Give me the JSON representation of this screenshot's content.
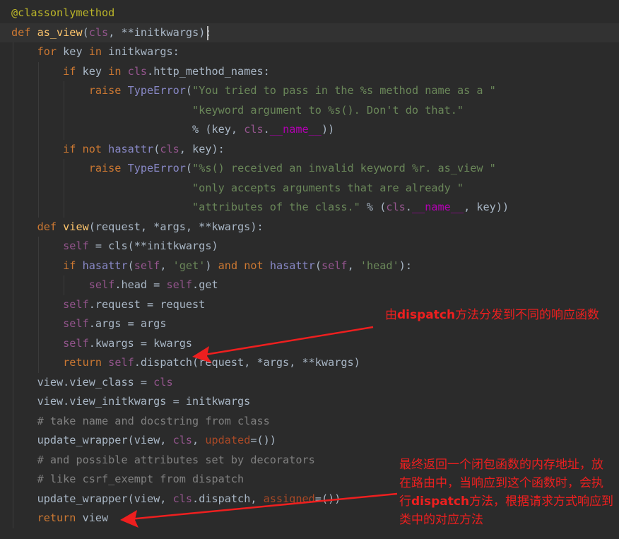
{
  "code_lines": [
    [
      {
        "t": "@classonlymethod",
        "c": "deco"
      }
    ],
    [
      {
        "t": "def ",
        "c": "kw"
      },
      {
        "t": "as_view",
        "c": "fn"
      },
      {
        "t": "("
      },
      {
        "t": "cls",
        "c": "self"
      },
      {
        "t": ", "
      },
      {
        "t": "**",
        "c": ""
      },
      {
        "t": "initkwargs):"
      }
    ],
    [
      {
        "t": "    "
      },
      {
        "t": "for ",
        "c": "kw"
      },
      {
        "t": "key "
      },
      {
        "t": "in ",
        "c": "kw"
      },
      {
        "t": "initkwargs:"
      }
    ],
    [
      {
        "t": "        "
      },
      {
        "t": "if ",
        "c": "kw"
      },
      {
        "t": "key "
      },
      {
        "t": "in ",
        "c": "kw"
      },
      {
        "t": "cls",
        "c": "self"
      },
      {
        "t": ".http_method_names:"
      }
    ],
    [
      {
        "t": "            "
      },
      {
        "t": "raise ",
        "c": "kw"
      },
      {
        "t": "TypeError",
        "c": "bi"
      },
      {
        "t": "("
      },
      {
        "t": "\"You tried to pass in the %s method name as a \"",
        "c": "str"
      }
    ],
    [
      {
        "t": "                            "
      },
      {
        "t": "\"keyword argument to %s(). Don't do that.\"",
        "c": "str"
      }
    ],
    [
      {
        "t": "                            "
      },
      {
        "t": "% (key, "
      },
      {
        "t": "cls",
        "c": "self"
      },
      {
        "t": "."
      },
      {
        "t": "__name__",
        "c": "dun"
      },
      {
        "t": "))"
      }
    ],
    [
      {
        "t": "        "
      },
      {
        "t": "if not ",
        "c": "kw"
      },
      {
        "t": "hasattr",
        "c": "bi"
      },
      {
        "t": "("
      },
      {
        "t": "cls",
        "c": "self"
      },
      {
        "t": ", key):"
      }
    ],
    [
      {
        "t": "            "
      },
      {
        "t": "raise ",
        "c": "kw"
      },
      {
        "t": "TypeError",
        "c": "bi"
      },
      {
        "t": "("
      },
      {
        "t": "\"%s() received an invalid keyword %r. as_view \"",
        "c": "str"
      }
    ],
    [
      {
        "t": "                            "
      },
      {
        "t": "\"only accepts arguments that are already \"",
        "c": "str"
      }
    ],
    [
      {
        "t": "                            "
      },
      {
        "t": "\"attributes of the class.\"",
        "c": "str"
      },
      {
        "t": " % ("
      },
      {
        "t": "cls",
        "c": "self"
      },
      {
        "t": "."
      },
      {
        "t": "__name__",
        "c": "dun"
      },
      {
        "t": ", key))"
      }
    ],
    [
      {
        "t": "    "
      },
      {
        "t": "def ",
        "c": "kw"
      },
      {
        "t": "view",
        "c": "fn"
      },
      {
        "t": "(request, *args, **kwargs):"
      }
    ],
    [
      {
        "t": "        "
      },
      {
        "t": "self",
        "c": "self"
      },
      {
        "t": " = cls(**initkwargs)"
      }
    ],
    [
      {
        "t": "        "
      },
      {
        "t": "if ",
        "c": "kw"
      },
      {
        "t": "hasattr",
        "c": "bi"
      },
      {
        "t": "("
      },
      {
        "t": "self",
        "c": "self"
      },
      {
        "t": ", "
      },
      {
        "t": "'get'",
        "c": "str"
      },
      {
        "t": ") "
      },
      {
        "t": "and not ",
        "c": "kw"
      },
      {
        "t": "hasattr",
        "c": "bi"
      },
      {
        "t": "("
      },
      {
        "t": "self",
        "c": "self"
      },
      {
        "t": ", "
      },
      {
        "t": "'head'",
        "c": "str"
      },
      {
        "t": "):"
      }
    ],
    [
      {
        "t": "            "
      },
      {
        "t": "self",
        "c": "self"
      },
      {
        "t": ".head = "
      },
      {
        "t": "self",
        "c": "self"
      },
      {
        "t": ".get"
      }
    ],
    [
      {
        "t": "        "
      },
      {
        "t": "self",
        "c": "self"
      },
      {
        "t": ".request = request"
      }
    ],
    [
      {
        "t": "        "
      },
      {
        "t": "self",
        "c": "self"
      },
      {
        "t": ".args = args"
      }
    ],
    [
      {
        "t": "        "
      },
      {
        "t": "self",
        "c": "self"
      },
      {
        "t": ".kwargs = kwargs"
      }
    ],
    [
      {
        "t": "        "
      },
      {
        "t": "return ",
        "c": "kw"
      },
      {
        "t": "self",
        "c": "self"
      },
      {
        "t": ".dispatch(request, *args, **kwargs)"
      }
    ],
    [
      {
        "t": "    "
      },
      {
        "t": "view.view_class = "
      },
      {
        "t": "cls",
        "c": "self"
      }
    ],
    [
      {
        "t": "    "
      },
      {
        "t": "view.view_initkwargs = initkwargs"
      }
    ],
    [
      {
        "t": "    "
      },
      {
        "t": "# take name and docstring from class",
        "c": "cmt"
      }
    ],
    [
      {
        "t": "    "
      },
      {
        "t": "update_wrapper(view, "
      },
      {
        "t": "cls",
        "c": "self"
      },
      {
        "t": ", "
      },
      {
        "t": "updated",
        "c": "par"
      },
      {
        "t": "=())"
      }
    ],
    [
      {
        "t": "    "
      },
      {
        "t": "# and possible attributes set by decorators",
        "c": "cmt"
      }
    ],
    [
      {
        "t": "    "
      },
      {
        "t": "# like csrf_exempt from dispatch",
        "c": "cmt"
      }
    ],
    [
      {
        "t": "    "
      },
      {
        "t": "update_wrapper(view, "
      },
      {
        "t": "cls",
        "c": "self"
      },
      {
        "t": ".dispatch, "
      },
      {
        "t": "assigned",
        "c": "par"
      },
      {
        "t": "=())"
      }
    ],
    [
      {
        "t": "    "
      },
      {
        "t": "return ",
        "c": "kw"
      },
      {
        "t": "view"
      }
    ]
  ],
  "annotations": {
    "dispatch_note": {
      "pre": "由",
      "hl": "dispatch",
      "post": "方法分发到不同的响应函数"
    },
    "return_note": {
      "pre": "最终返回一个闭包函数的内存地址，放在路由中，当响应到这个函数时，会执行",
      "hl": "dispatch",
      "post": "方法，根据请求方式响应到类中的对应方法"
    }
  },
  "colors": {
    "background": "#2b2b2b",
    "keyword": "#cc7832",
    "string": "#6a8759",
    "comment": "#808080",
    "annotation_red": "#ee1f1f"
  }
}
